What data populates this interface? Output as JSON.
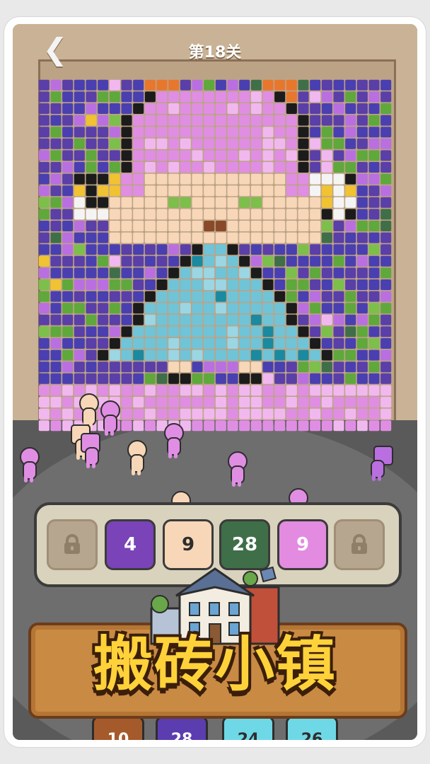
{
  "header": {
    "back_icon": "chevron-left-icon",
    "level_title": "第18关"
  },
  "tray": {
    "slots": [
      {
        "type": "locked",
        "icon": "lock-icon",
        "color": "#b7a68f"
      },
      {
        "type": "count",
        "value": "4",
        "color": "#7a43b7",
        "text_color": "#ffffff"
      },
      {
        "type": "count",
        "value": "9",
        "color": "#f7d7b7",
        "text_color": "#2d2d2d"
      },
      {
        "type": "count",
        "value": "28",
        "color": "#3f6f48",
        "text_color": "#ffffff"
      },
      {
        "type": "count",
        "value": "9",
        "color": "#e28be0",
        "text_color": "#ffffff"
      },
      {
        "type": "locked",
        "icon": "lock-icon",
        "color": "#b7a68f"
      }
    ]
  },
  "logo": {
    "title": "搬砖小镇",
    "emblem": "town-building-icon"
  },
  "bottom_tiles": [
    {
      "value": "10",
      "color": "#a55a2b"
    },
    {
      "value": "28",
      "color": "#5b3db0"
    },
    {
      "value": "24",
      "color": "#6fd8e6"
    },
    {
      "value": "26",
      "color": "#6fd8e6"
    }
  ],
  "colors": {
    "accent_purple": "#7a43b7",
    "mosaic_bg": "#4a3fb0",
    "dress": "#6fc4d8",
    "skin": "#f7d7b7",
    "hair": "#e08ee4",
    "leaf": "#5fa83c"
  }
}
